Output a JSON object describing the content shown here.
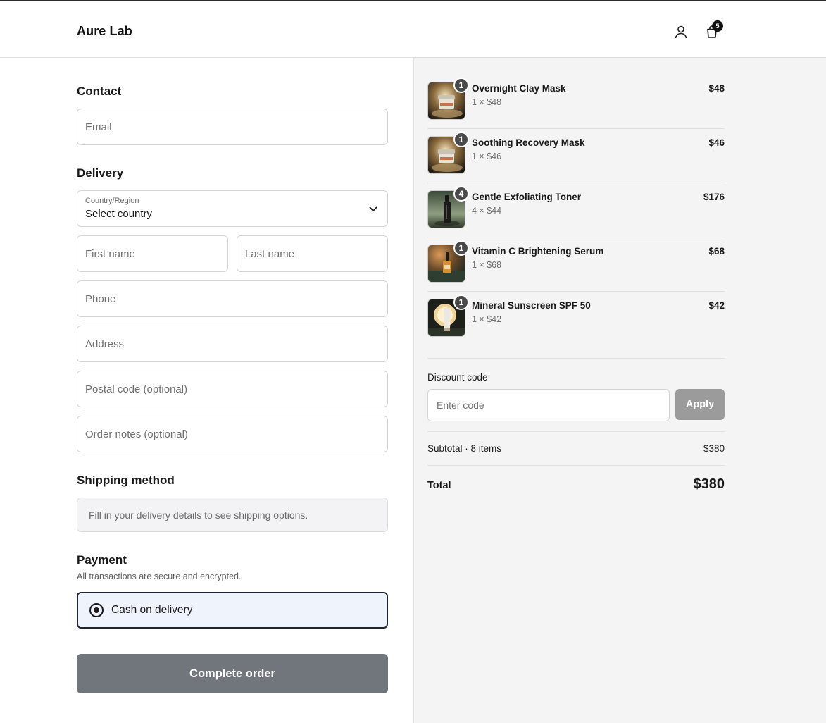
{
  "header": {
    "brand": "Aure Lab",
    "cart_count": "5",
    "icons": [
      "account-icon",
      "cart-icon"
    ]
  },
  "contact": {
    "title": "Contact",
    "email_placeholder": "Email"
  },
  "delivery": {
    "title": "Delivery",
    "country_label": "Country/Region",
    "country_value": "Select country",
    "first_name_placeholder": "First name",
    "last_name_placeholder": "Last name",
    "phone_placeholder": "Phone",
    "address_placeholder": "Address",
    "postal_placeholder": "Postal code (optional)",
    "notes_placeholder": "Order notes (optional)"
  },
  "shipping": {
    "title": "Shipping method",
    "message": "Fill in your delivery details to see shipping options."
  },
  "payment": {
    "title": "Payment",
    "subtitle": "All transactions are secure and encrypted.",
    "option_label": "Cash on delivery",
    "selected": true
  },
  "complete_button": "Complete order",
  "order": {
    "items": [
      {
        "qty": "1",
        "name": "Overnight Clay Mask",
        "unit": "1 × $48",
        "price": "$48",
        "image": "jar-icon"
      },
      {
        "qty": "1",
        "name": "Soothing Recovery Mask",
        "unit": "1 × $46",
        "price": "$46",
        "image": "jar-icon"
      },
      {
        "qty": "4",
        "name": "Gentle Exfoliating Toner",
        "unit": "4 × $44",
        "price": "$176",
        "image": "bottle-icon"
      },
      {
        "qty": "1",
        "name": "Vitamin C Brightening Serum",
        "unit": "1 × $68",
        "price": "$68",
        "image": "dropper-icon"
      },
      {
        "qty": "1",
        "name": "Mineral Sunscreen SPF 50",
        "unit": "1 × $42",
        "price": "$42",
        "image": "tube-icon"
      }
    ],
    "discount_label": "Discount code",
    "discount_placeholder": "Enter code",
    "apply_label": "Apply",
    "subtotal_label": "Subtotal · 8 items",
    "subtotal_value": "$380",
    "total_label": "Total",
    "total_value": "$380"
  },
  "colors": {
    "primary_button": "#71757c",
    "apply_button": "#9b9b9b",
    "payment_selected_bg": "#eef3fc",
    "summary_bg": "#f4f4f4"
  }
}
